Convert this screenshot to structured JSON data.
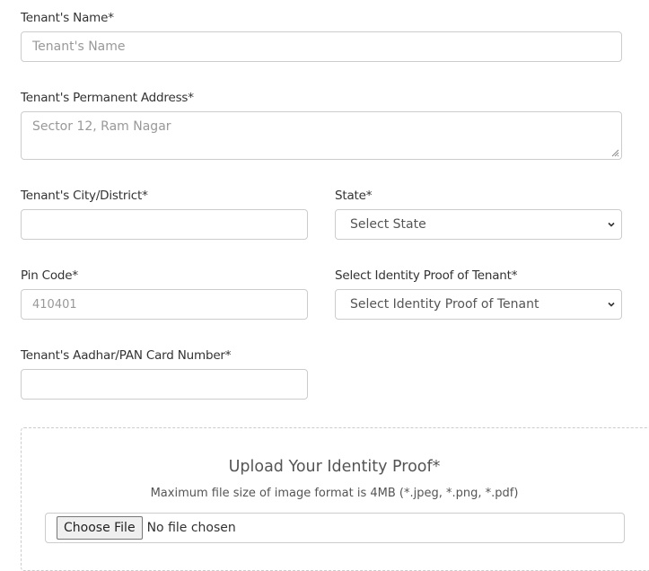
{
  "form": {
    "tenant_name": {
      "label": "Tenant's Name*",
      "value": "",
      "placeholder": "Tenant's Name"
    },
    "permanent_address": {
      "label": "Tenant's Permanent Address*",
      "value": "",
      "placeholder": "Sector 12, Ram Nagar"
    },
    "city_district": {
      "label": "Tenant's City/District*",
      "value": "",
      "placeholder": ""
    },
    "state": {
      "label": "State*",
      "selected": "Select State"
    },
    "pin_code": {
      "label": "Pin Code*",
      "value": "",
      "placeholder": "410401"
    },
    "identity_proof_type": {
      "label": "Select Identity Proof of Tenant*",
      "selected": "Select Identity Proof of Tenant"
    },
    "aadhar_pan": {
      "label": "Tenant's Aadhar/PAN Card Number*",
      "value": "",
      "placeholder": ""
    }
  },
  "upload": {
    "title": "Upload Your Identity Proof*",
    "hint": "Maximum file size of image format is 4MB (*.jpeg, *.png, *.pdf)",
    "button_label": "Choose File",
    "status": "No file chosen"
  }
}
